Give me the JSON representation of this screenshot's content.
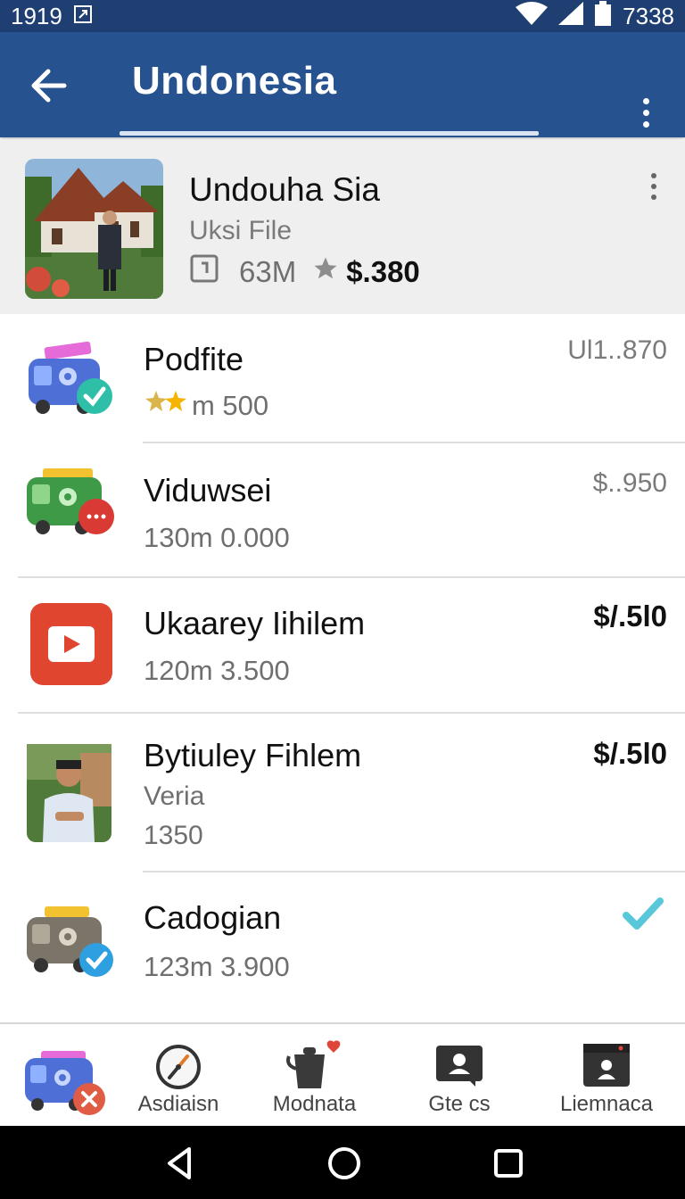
{
  "status_bar": {
    "time": "1919",
    "battery": "7338"
  },
  "header": {
    "title": "Undonesia"
  },
  "featured": {
    "title": "Undouha Sia",
    "subtitle": "Uksi File",
    "size": "63M",
    "price": "$.380"
  },
  "items": [
    {
      "title": "Podfite",
      "sub": "m 500",
      "price": "Ul1..870"
    },
    {
      "title": "Viduwsei",
      "sub": "130m 0.000",
      "price": "$..950"
    },
    {
      "title": "Ukaarey Iihilem",
      "sub": "120m 3.500",
      "price": "$/.5l0"
    },
    {
      "title": "Bytiuley Fihlem",
      "sub": "Veria",
      "sub2": "1350",
      "price": "$/.5l0"
    },
    {
      "title": "Cadogian",
      "sub": "123m 3.900"
    }
  ],
  "bottom_nav": [
    {
      "label": ""
    },
    {
      "label": "Asdiaisn"
    },
    {
      "label": "Modnata"
    },
    {
      "label": "Gte cs"
    },
    {
      "label": "Liemnaca"
    }
  ],
  "colors": {
    "appbar": "#26528f",
    "statusbar": "#1f3f73",
    "accent_teal": "#2bb3c8",
    "youtube_red": "#e0452f"
  }
}
